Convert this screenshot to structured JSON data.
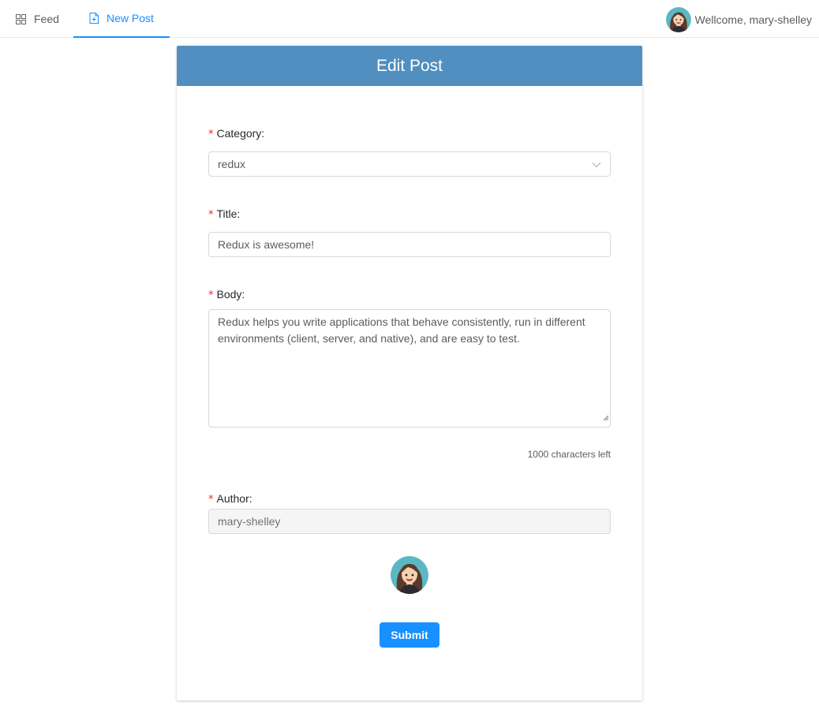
{
  "nav": {
    "items": [
      {
        "label": "Feed",
        "icon": "grid-icon"
      },
      {
        "label": "New Post",
        "icon": "file-add-icon",
        "active": true
      }
    ],
    "welcome": "Wellcome, mary-shelley",
    "accent_color": "#1890ff"
  },
  "form": {
    "title": "Edit Post",
    "header_color": "#508fc0",
    "category": {
      "label": "Category:",
      "value": "redux"
    },
    "title_field": {
      "label": "Title:",
      "value": "Redux is awesome!"
    },
    "body": {
      "label": "Body:",
      "value": "Redux helps you write applications that behave consistently, run in different environments (client, server, and native), and are easy to test.",
      "counter": "1000 characters left"
    },
    "author": {
      "label": "Author:",
      "value": "mary-shelley"
    },
    "submit_label": "Submit",
    "required_marker": "*"
  }
}
